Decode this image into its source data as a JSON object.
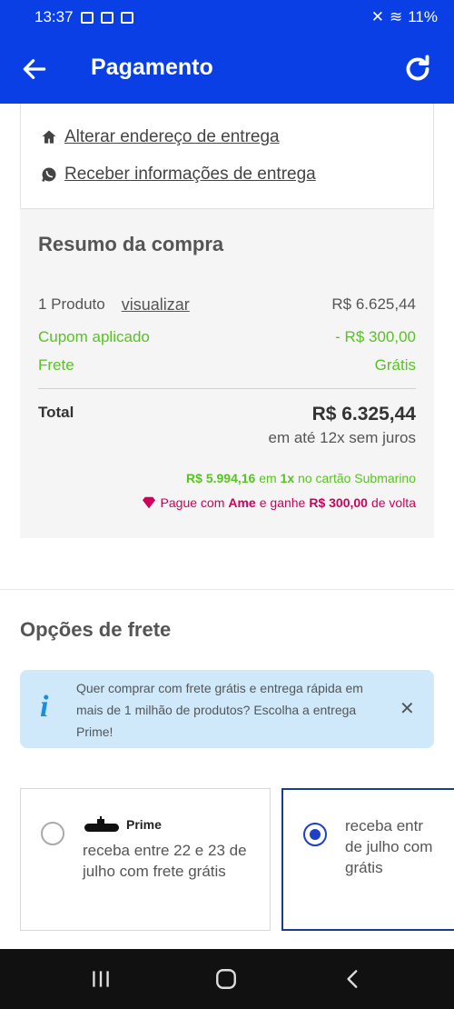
{
  "status_bar": {
    "time": "13:37",
    "battery": "11%"
  },
  "app_bar": {
    "title": "Pagamento"
  },
  "delivery_links": {
    "change_address": "Alterar endereço de entrega",
    "receive_info": "Receber informações de entrega"
  },
  "summary": {
    "title": "Resumo da compra",
    "products_label": "1 Produto",
    "view_label": "visualizar",
    "products_value": "R$ 6.625,44",
    "coupon_label": "Cupom aplicado",
    "coupon_value": "- R$ 300,00",
    "shipping_label": "Frete",
    "shipping_value": "Grátis",
    "total_label": "Total",
    "total_value": "R$ 6.325,44",
    "installments": "em até 12x sem juros",
    "submarino_price": "R$ 5.994,16",
    "submarino_in": "em",
    "submarino_times": "1x",
    "submarino_card": "no cartão Submarino",
    "ame_pay": "Pague com",
    "ame_brand": "Ame",
    "ame_earn": "e ganhe",
    "ame_amount": "R$ 300,00",
    "ame_back": "de volta"
  },
  "shipping_options": {
    "title": "Opções de frete",
    "info": "Quer comprar com frete grátis e entrega rápida em mais de 1 milhão de produtos? Escolha a entrega Prime!",
    "prime_label": "Prime",
    "option1_text": "receba entre 22 e 23 de julho com frete grátis",
    "option2_text": "receba entr\nde julho com\ngrátis"
  },
  "colors": {
    "primary": "#0a3fe6",
    "green": "#58c322",
    "ame": "#d1005d",
    "info_bg": "#cfe9fb"
  },
  "icons": [
    "back-arrow-icon",
    "refresh-icon",
    "home-icon",
    "whatsapp-icon",
    "info-icon",
    "close-icon",
    "heart-icon",
    "submarine-icon"
  ]
}
